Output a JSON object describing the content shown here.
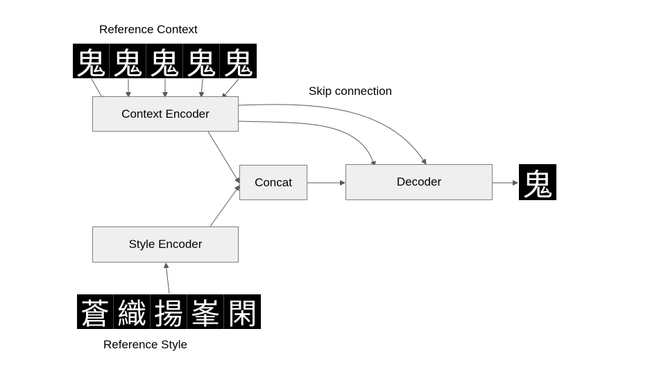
{
  "labels": {
    "reference_context": "Reference Context",
    "reference_style": "Reference Style",
    "skip_connection": "Skip connection"
  },
  "nodes": {
    "context_encoder": "Context Encoder",
    "style_encoder": "Style Encoder",
    "concat": "Concat",
    "decoder": "Decoder"
  },
  "context_glyphs": [
    "鬼",
    "鬼",
    "鬼",
    "鬼",
    "鬼"
  ],
  "style_glyphs": [
    "蒼",
    "織",
    "揚",
    "峯",
    "閑"
  ],
  "output_glyph": "鬼",
  "colors": {
    "box_fill": "#efefef",
    "box_border": "#7f7f7f",
    "arrow": "#595959"
  }
}
